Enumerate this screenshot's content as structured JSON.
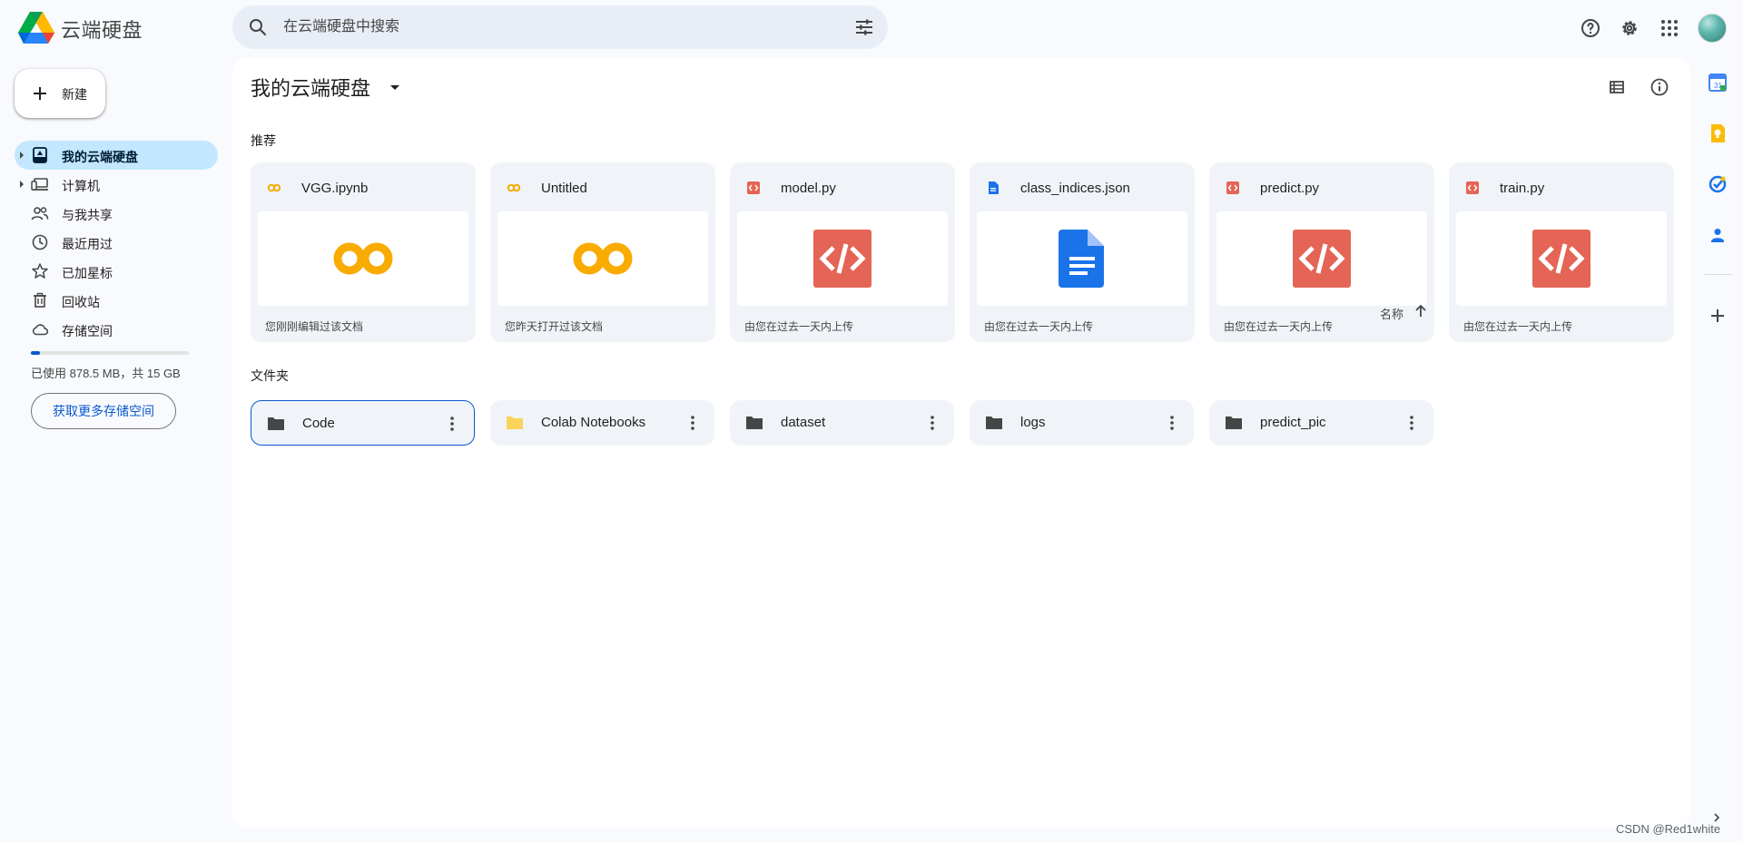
{
  "header": {
    "app_title": "云端硬盘",
    "search_placeholder": "在云端硬盘中搜索",
    "icons": [
      "search-icon",
      "filter-icon",
      "help-icon",
      "settings-icon",
      "apps-grid-icon",
      "avatar"
    ]
  },
  "sidebar": {
    "new_label": "新建",
    "items": [
      {
        "label": "我的云端硬盘",
        "icon": "my-drive-icon",
        "active": true,
        "expandable": true
      },
      {
        "label": "计算机",
        "icon": "computers-icon",
        "active": false,
        "expandable": true
      },
      {
        "label": "与我共享",
        "icon": "shared-icon",
        "active": false,
        "expandable": false
      },
      {
        "label": "最近用过",
        "icon": "recent-icon",
        "active": false,
        "expandable": false
      },
      {
        "label": "已加星标",
        "icon": "star-icon",
        "active": false,
        "expandable": false
      },
      {
        "label": "回收站",
        "icon": "trash-icon",
        "active": false,
        "expandable": false
      },
      {
        "label": "存储空间",
        "icon": "cloud-icon",
        "active": false,
        "expandable": false
      }
    ],
    "storage_text": "已使用 878.5 MB，共 15 GB",
    "storage_used_fraction": 0.057,
    "get_more_label": "获取更多存储空间"
  },
  "main": {
    "title": "我的云端硬盘",
    "suggested_label": "推荐",
    "folders_label": "文件夹",
    "sort_label": "名称",
    "suggested": [
      {
        "name": "VGG.ipynb",
        "type": "colab",
        "subtitle": "您刚刚编辑过该文档"
      },
      {
        "name": "Untitled",
        "type": "colab",
        "subtitle": "您昨天打开过该文档"
      },
      {
        "name": "model.py",
        "type": "code",
        "subtitle": "由您在过去一天内上传"
      },
      {
        "name": "class_indices.json",
        "type": "doc",
        "subtitle": "由您在过去一天内上传"
      },
      {
        "name": "predict.py",
        "type": "code",
        "subtitle": "由您在过去一天内上传"
      },
      {
        "name": "train.py",
        "type": "code",
        "subtitle": "由您在过去一天内上传"
      }
    ],
    "folders": [
      {
        "name": "Code",
        "color": "#444746",
        "selected": true
      },
      {
        "name": "Colab Notebooks",
        "color": "#fbd35a",
        "selected": false
      },
      {
        "name": "dataset",
        "color": "#444746",
        "selected": false
      },
      {
        "name": "logs",
        "color": "#444746",
        "selected": false
      },
      {
        "name": "predict_pic",
        "color": "#444746",
        "selected": false
      }
    ]
  },
  "side_panel": {
    "icons": [
      "calendar-icon",
      "keep-icon",
      "tasks-icon",
      "contacts-icon",
      "add-icon"
    ]
  },
  "watermark": "CSDN @Red1white",
  "colors": {
    "accent": "#0b57d0",
    "active_nav": "#c2e7ff",
    "card_bg": "#f0f4f9",
    "code_red": "#e46555",
    "doc_blue": "#1a73e8",
    "colab_yellow": "#f9ab00"
  }
}
